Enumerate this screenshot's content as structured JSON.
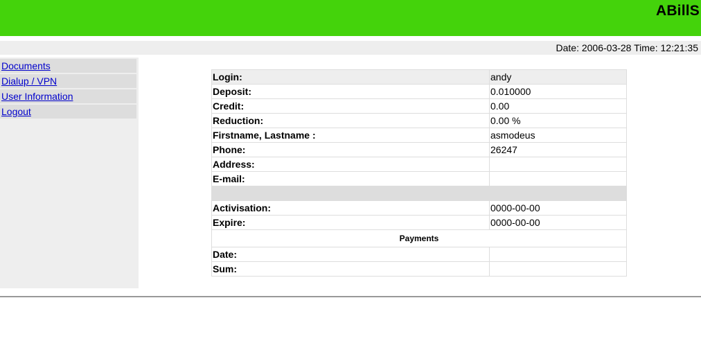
{
  "header": {
    "title": "ABillS",
    "brand_color": "#44d30b"
  },
  "datebar": {
    "date_label": "Date:",
    "date": "2006-03-28",
    "time_label": "Time:",
    "time": "12:21:35"
  },
  "sidebar": {
    "items": [
      {
        "label": "Documents"
      },
      {
        "label": "Dialup / VPN"
      },
      {
        "label": "User Information"
      },
      {
        "label": "Logout"
      }
    ],
    "link_color": "#0000cc"
  },
  "user_info": {
    "login": {
      "label": "Login:",
      "value": "andy"
    },
    "deposit": {
      "label": "Deposit:",
      "value": "0.010000"
    },
    "credit": {
      "label": "Credit:",
      "value": "0.00"
    },
    "reduction": {
      "label": "Reduction:",
      "value": "0.00 %"
    },
    "name": {
      "label": "Firstname, Lastname :",
      "value": "asmodeus"
    },
    "phone": {
      "label": "Phone:",
      "value": "26247"
    },
    "address": {
      "label": "Address:",
      "value": ""
    },
    "email": {
      "label": "E-mail:",
      "value": ""
    },
    "activisation": {
      "label": "Activisation:",
      "value": "0000-00-00"
    },
    "expire": {
      "label": "Expire:",
      "value": "0000-00-00"
    }
  },
  "payments": {
    "title": "Payments",
    "date": {
      "label": "Date:",
      "value": ""
    },
    "sum": {
      "label": "Sum:",
      "value": ""
    }
  }
}
